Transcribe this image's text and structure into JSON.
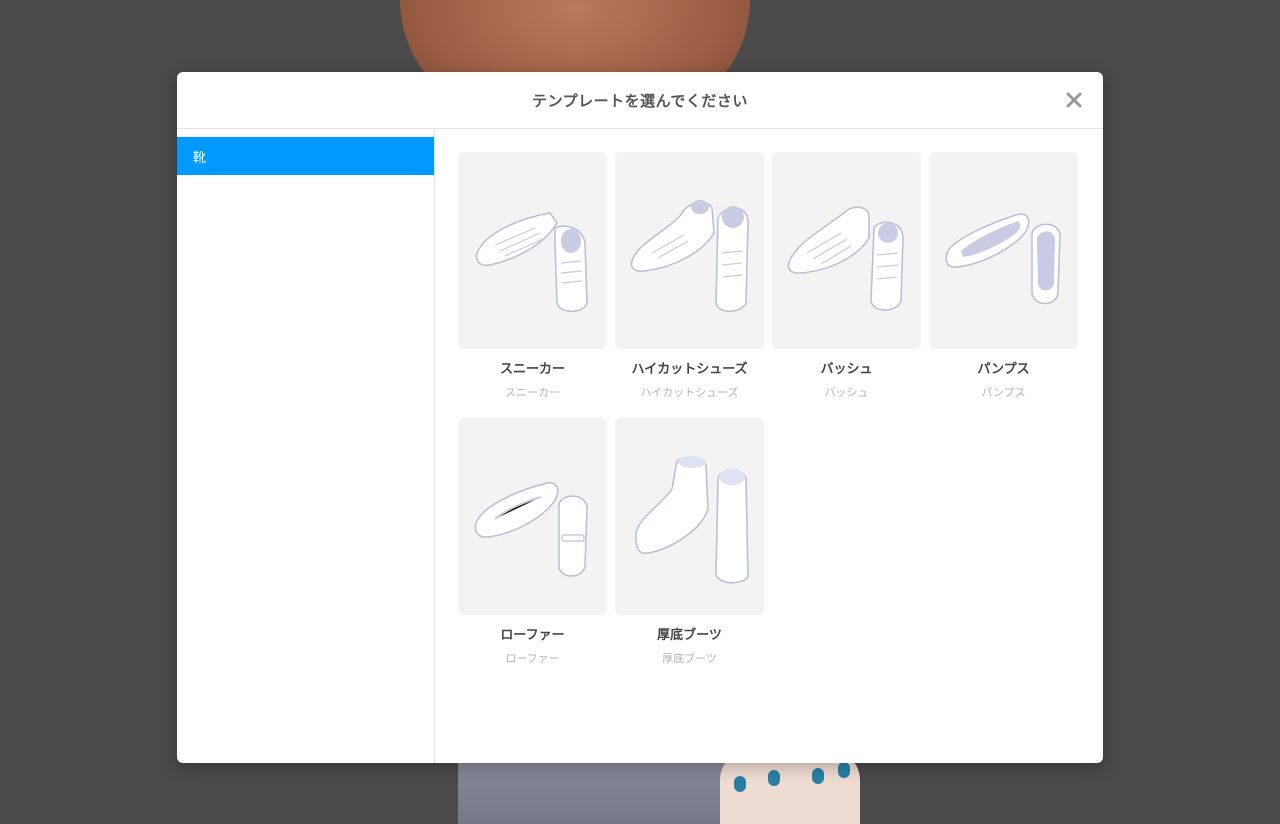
{
  "modal": {
    "title": "テンプレートを選んでください",
    "close_icon": "close-icon"
  },
  "sidebar": {
    "items": [
      {
        "label": "靴",
        "selected": true
      }
    ]
  },
  "templates": [
    {
      "name": "スニーカー",
      "subtitle": "スニーカー",
      "icon": "sneaker-icon"
    },
    {
      "name": "ハイカットシューズ",
      "subtitle": "ハイカットシューズ",
      "icon": "high-cut-shoes-icon"
    },
    {
      "name": "バッシュ",
      "subtitle": "バッシュ",
      "icon": "basketball-shoes-icon"
    },
    {
      "name": "パンプス",
      "subtitle": "パンプス",
      "icon": "pumps-icon"
    },
    {
      "name": "ローファー",
      "subtitle": "ローファー",
      "icon": "loafer-icon"
    },
    {
      "name": "厚底ブーツ",
      "subtitle": "厚底ブーツ",
      "icon": "platform-boots-icon"
    }
  ],
  "colors": {
    "accent": "#0099ff",
    "thumb_bg": "#f3f3f3",
    "overlay": "#4a4a4a"
  }
}
